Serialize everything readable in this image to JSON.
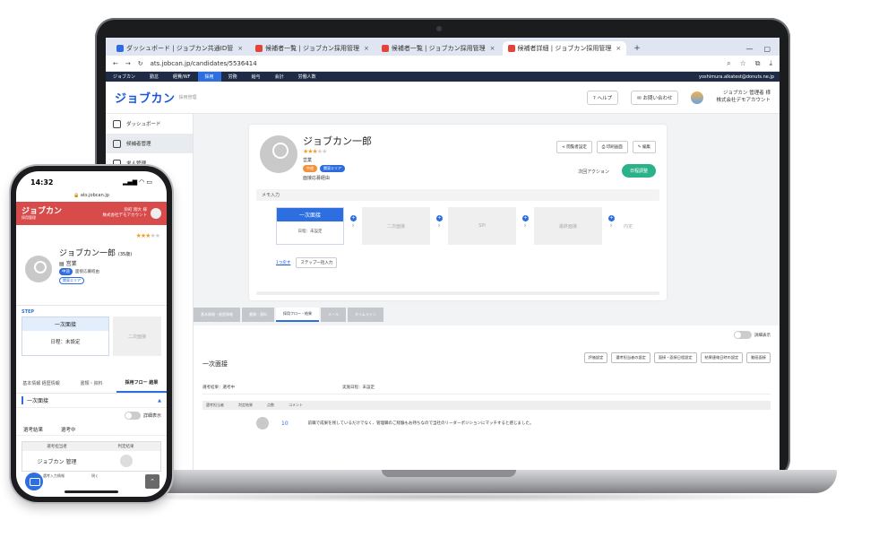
{
  "browser": {
    "tabs": [
      {
        "label": "ダッシュボード | ジョブカン共通ID管"
      },
      {
        "label": "候補者一覧 | ジョブカン採用管理"
      },
      {
        "label": "候補者一覧 | ジョブカン採用管理"
      },
      {
        "label": "候補者詳細 | ジョブカン採用管理"
      }
    ],
    "new_tab": "+",
    "url": "ats.jobcan.jp/candidates/5536414"
  },
  "app_nav": {
    "items": [
      "ジョブカン",
      "勤怠",
      "経費/WF",
      "採用",
      "労務",
      "給与",
      "会計",
      "労働人数"
    ],
    "active_index": 3,
    "user_email": "yoshimura.alkatest@donuts.ne.jp"
  },
  "header": {
    "logo": "ジョブカン",
    "logo_sub": "採用管理",
    "help": "ヘルプ",
    "contact": "お問い合わせ",
    "user_line1": "ジョブカン 管理者 様",
    "user_line2": "株式会社デモアカウント"
  },
  "sidebar": {
    "items": [
      {
        "label": "ダッシュボード"
      },
      {
        "label": "候補者管理"
      },
      {
        "label": "求人管理"
      }
    ],
    "active_index": 1
  },
  "candidate": {
    "name": "ジョブカン一郎",
    "rating": 3,
    "rating_max": 5,
    "dept": "営業",
    "tag1": "中途",
    "tag2": "関東エリア",
    "reason": "面接応募経由",
    "actions": [
      "閲覧者設定",
      "印刷画面",
      "編集"
    ],
    "next_action_label": "次回アクション",
    "next_action_btn": "日程調整",
    "memo_placeholder": "メモ入力"
  },
  "steps": {
    "active_title": "一次面接",
    "active_sub": "日程：未設定",
    "others": [
      "二次面接",
      "SPI",
      "最終面接"
    ],
    "final": "内定",
    "undo": "1つ戻す",
    "skip": "ステップ一括入力"
  },
  "subtabs": [
    "基本情報・経歴情報",
    "書類・資料",
    "採用フロー・結果",
    "メール",
    "タイムライン"
  ],
  "subtabs_active": 2,
  "panel": {
    "toggle_label": "詳細表示",
    "title": "一次面接",
    "buttons": [
      "評価設定",
      "選考担当者の設定",
      "面接・面接日程設定",
      "結果連絡日時の設定",
      "動画面接"
    ],
    "status_label": "選考結果：選考中",
    "date_label": "実施日程：未設定",
    "grid_headers": [
      "選考担当者",
      "判定結果",
      "点数",
      "コメント"
    ],
    "grid_row": {
      "score": "10",
      "comment": "前職で成果を残しているだけでなく、管理職のご経験もお持ちなので当社のリーダーポジションにマッチすると感じました。"
    }
  },
  "phone": {
    "time": "14:32",
    "url": "ats.jobcan.jp",
    "logo": "ジョブカン",
    "logo_sub": "採用管理",
    "user_line1": "鈴町 翔大 様",
    "user_line2": "株式会社デモアカウント",
    "name": "ジョブカン一郎",
    "age": "(35歳)",
    "dept": "営業",
    "tag1": "中途",
    "reason": "面接応募経由",
    "tag2": "関東エリア",
    "step_label": "STEP",
    "step_title": "一次面接",
    "step_sub": "日程：未設定",
    "step_next": "二次面接",
    "tabs": [
      "基本情報 経歴情報",
      "書類・資料",
      "採用フロー 結果"
    ],
    "section": "一次面接",
    "toggle_label": "詳細表示",
    "result_label": "選考結果",
    "result_value": "選考中",
    "table_headers": [
      "選考担当者",
      "判定結果"
    ],
    "table_person": "ジョブカン 管理",
    "footer_cols": [
      "選考入力情報",
      "現く"
    ]
  },
  "colors": {
    "accent": "#2d6fe0",
    "brand": "#1a58d6",
    "next_btn": "#2cb28a",
    "phone_header": "#d84b4b",
    "star": "#f0a020"
  }
}
